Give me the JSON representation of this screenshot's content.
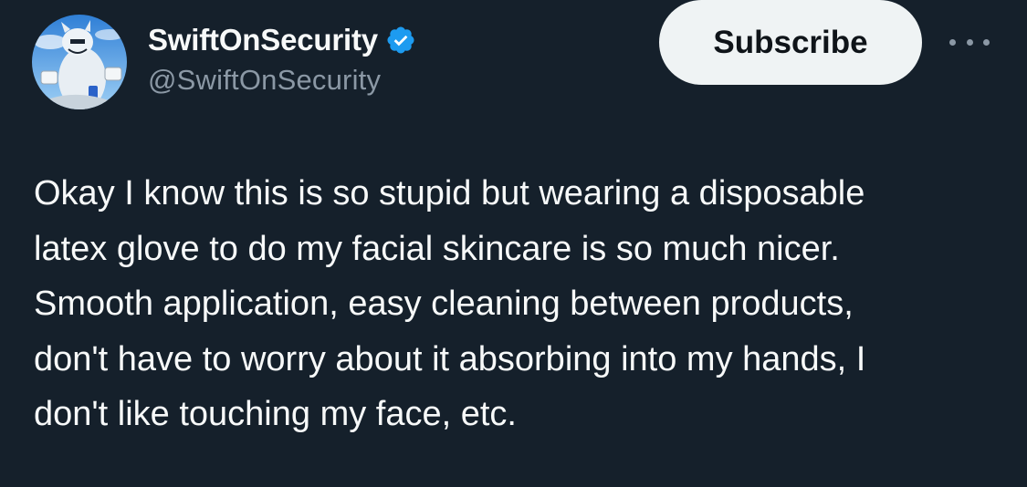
{
  "author": {
    "display_name": "SwiftOnSecurity",
    "handle": "@SwiftOnSecurity",
    "verified": true,
    "avatar_icon": "avatar-image"
  },
  "actions": {
    "subscribe_label": "Subscribe",
    "more_icon": "more-horizontal-icon"
  },
  "tweet": {
    "lines": [
      "Okay I know this is so stupid but wearing a disposable",
      "latex glove to do my facial skincare is so much nicer.",
      "Smooth application, easy cleaning between products,",
      "don't have to worry about it absorbing into my hands, I",
      "don't like touching my face, etc."
    ]
  },
  "colors": {
    "background": "#15202b",
    "text_primary": "#f7f9f9",
    "text_secondary": "#8b98a5",
    "verified_blue": "#1d9bf0",
    "button_bg": "#eff3f4",
    "button_text": "#0f1419"
  }
}
